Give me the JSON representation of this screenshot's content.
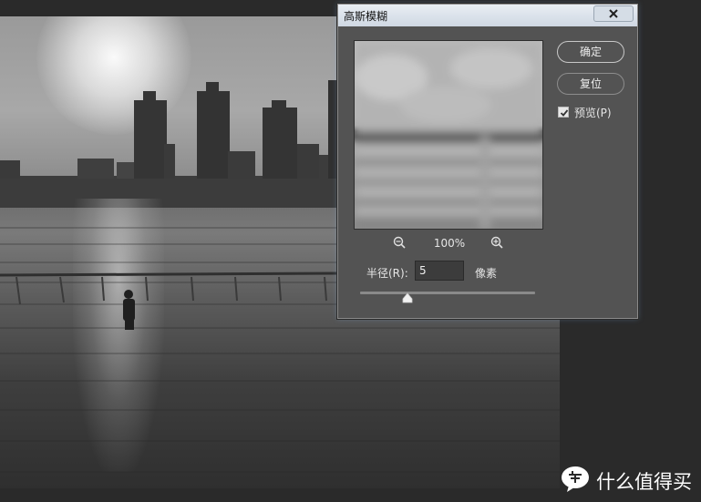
{
  "dialog": {
    "title": "高斯模糊",
    "buttons": {
      "ok": "确定",
      "reset": "复位"
    },
    "preview": {
      "label": "预览(P)",
      "checked": true
    },
    "zoom": {
      "level": "100%"
    },
    "radius": {
      "label": "半径(R):",
      "value": "5",
      "unit": "像素",
      "slider_level_fraction": 0.27
    }
  },
  "icons": {
    "close": "close-icon",
    "zoom_out": "zoom-out-icon",
    "zoom_in": "zoom-in-icon",
    "checkmark": "checkmark-icon",
    "slider_thumb": "triangle-slider-thumb",
    "watermark_logo": "speech-bubble-logo"
  },
  "watermark": {
    "text": "什么值得买"
  },
  "colors": {
    "dialog_bg": "#535353",
    "titlebar": "#dbe3ec",
    "text": "#e6e6e6"
  }
}
